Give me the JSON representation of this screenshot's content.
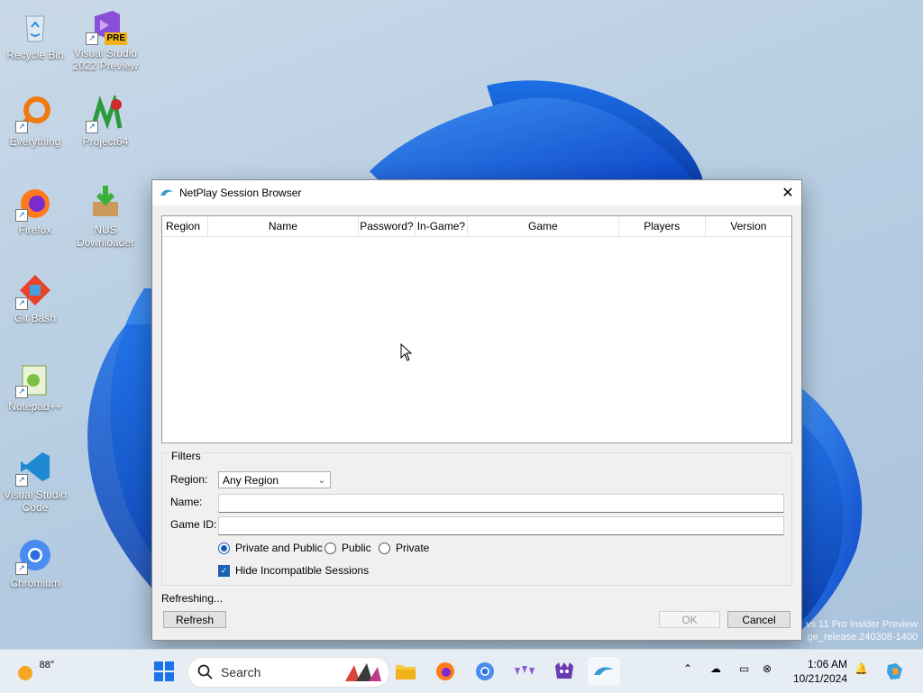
{
  "desktop": {
    "icons": [
      {
        "label": "Recycle Bin"
      },
      {
        "label": "Visual Studio 2022 Preview",
        "badge": "PRE"
      },
      {
        "label": "Everything"
      },
      {
        "label": "Project64"
      },
      {
        "label": "Firefox"
      },
      {
        "label": "NUS Downloader"
      },
      {
        "label": "Git Bash"
      },
      {
        "label": "Notepad++"
      },
      {
        "label": "Visual Studio Code"
      },
      {
        "label": "Chromium"
      }
    ],
    "watermark_line1": "vs 11 Pro Insider Preview",
    "watermark_line2": "ge_release.240308-1400"
  },
  "dialog": {
    "title": "NetPlay Session Browser",
    "columns": [
      "Region",
      "Name",
      "Password?",
      "In-Game?",
      "Game",
      "Players",
      "Version"
    ],
    "filters": {
      "title": "Filters",
      "region_label": "Region:",
      "region_value": "Any Region",
      "name_label": "Name:",
      "name_value": "",
      "gameid_label": "Game ID:",
      "gameid_value": "",
      "visibility_options": [
        "Private and Public",
        "Public",
        "Private"
      ],
      "visibility_selected": "Private and Public",
      "hide_incompatible_label": "Hide Incompatible Sessions",
      "hide_incompatible_checked": true
    },
    "status": "Refreshing...",
    "refresh_label": "Refresh",
    "ok_label": "OK",
    "cancel_label": "Cancel"
  },
  "taskbar": {
    "weather_temp": "88°",
    "search_placeholder": "Search",
    "time": "1:06 AM",
    "date": "10/21/2024"
  },
  "colors": {
    "accent": "#1a5fb4"
  }
}
